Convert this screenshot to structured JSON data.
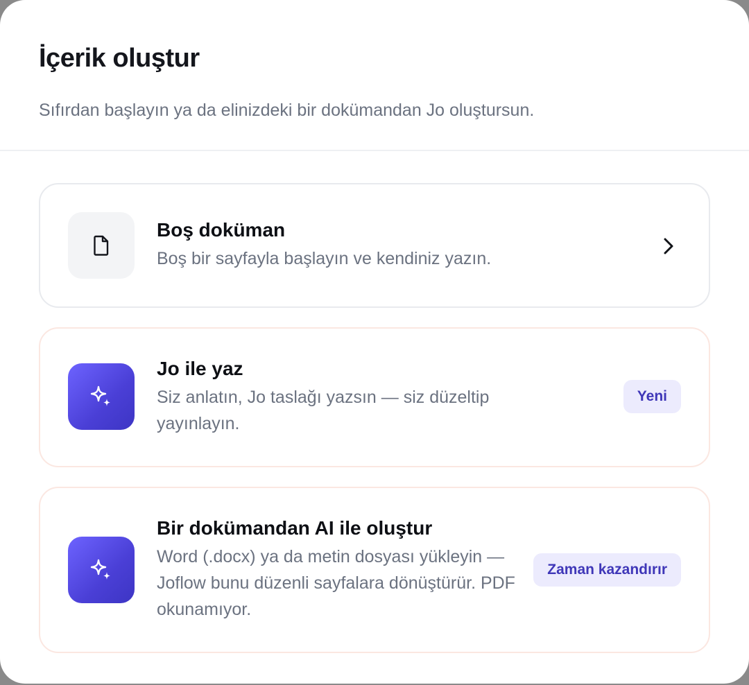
{
  "dialog": {
    "title": "İçerik oluştur",
    "subtitle": "Sıfırdan başlayın ya da elinizdeki bir dokümandan Jo oluştursun."
  },
  "options": [
    {
      "title": "Boş doküman",
      "description": "Boş bir sayfayla başlayın ve kendiniz yazın.",
      "icon": "document-icon",
      "trailing": "chevron-right-icon"
    },
    {
      "title": "Jo ile yaz",
      "description": "Siz anlatın, Jo taslağı yazsın — siz düzeltip yayınlayın.",
      "icon": "sparkles-icon",
      "badge": "Yeni"
    },
    {
      "title": "Bir dokümandan AI ile oluştur",
      "description": "Word (.docx) ya da metin dosyası yükleyin — Joflow bunu düzenli sayfalara dönüştürür. PDF okunamıyor.",
      "icon": "sparkles-icon",
      "badge": "Zaman kazandırır"
    }
  ],
  "colors": {
    "accent": "#5147e0",
    "badge_bg": "#ecebfd",
    "badge_text": "#3f37b8",
    "muted_text": "#6b7280",
    "ai_card_border": "#fbe7e1"
  }
}
